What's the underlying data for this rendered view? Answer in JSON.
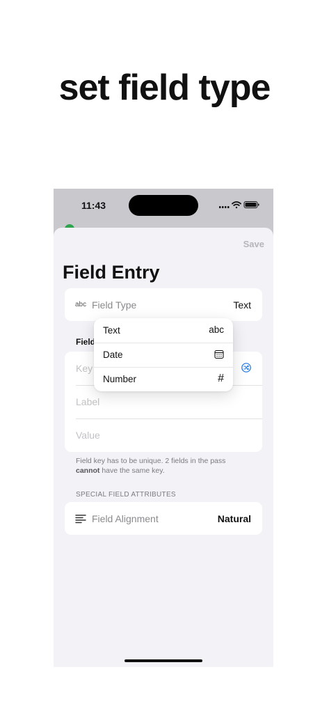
{
  "headline": "set field type",
  "status_bar": {
    "time": "11:43"
  },
  "nav": {
    "save_label": "Save"
  },
  "page_title": "Field Entry",
  "field_type": {
    "icon_text": "abc",
    "label": "Field Type",
    "value": "Text"
  },
  "menu": {
    "items": [
      {
        "label": "Text",
        "icon": "abc"
      },
      {
        "label": "Date",
        "icon": "calendar-icon"
      },
      {
        "label": "Number",
        "icon": "#"
      }
    ]
  },
  "field_section": {
    "header": "Field"
  },
  "inputs": {
    "key_placeholder": "Key",
    "label_placeholder": "Label",
    "value_placeholder": "Value"
  },
  "footnote": {
    "part1": "Field key has to be unique. 2 fields in the pass ",
    "bold": "cannot",
    "part2": " have the same key."
  },
  "special_attributes": {
    "header": "SPECIAL FIELD ATTRIBUTES",
    "alignment_label": "Field Alignment",
    "alignment_value": "Natural"
  },
  "colors": {
    "accent": "#1a73e8",
    "sheet_bg": "#f2f2f7",
    "dimmed_bg": "#c9c9cd"
  }
}
